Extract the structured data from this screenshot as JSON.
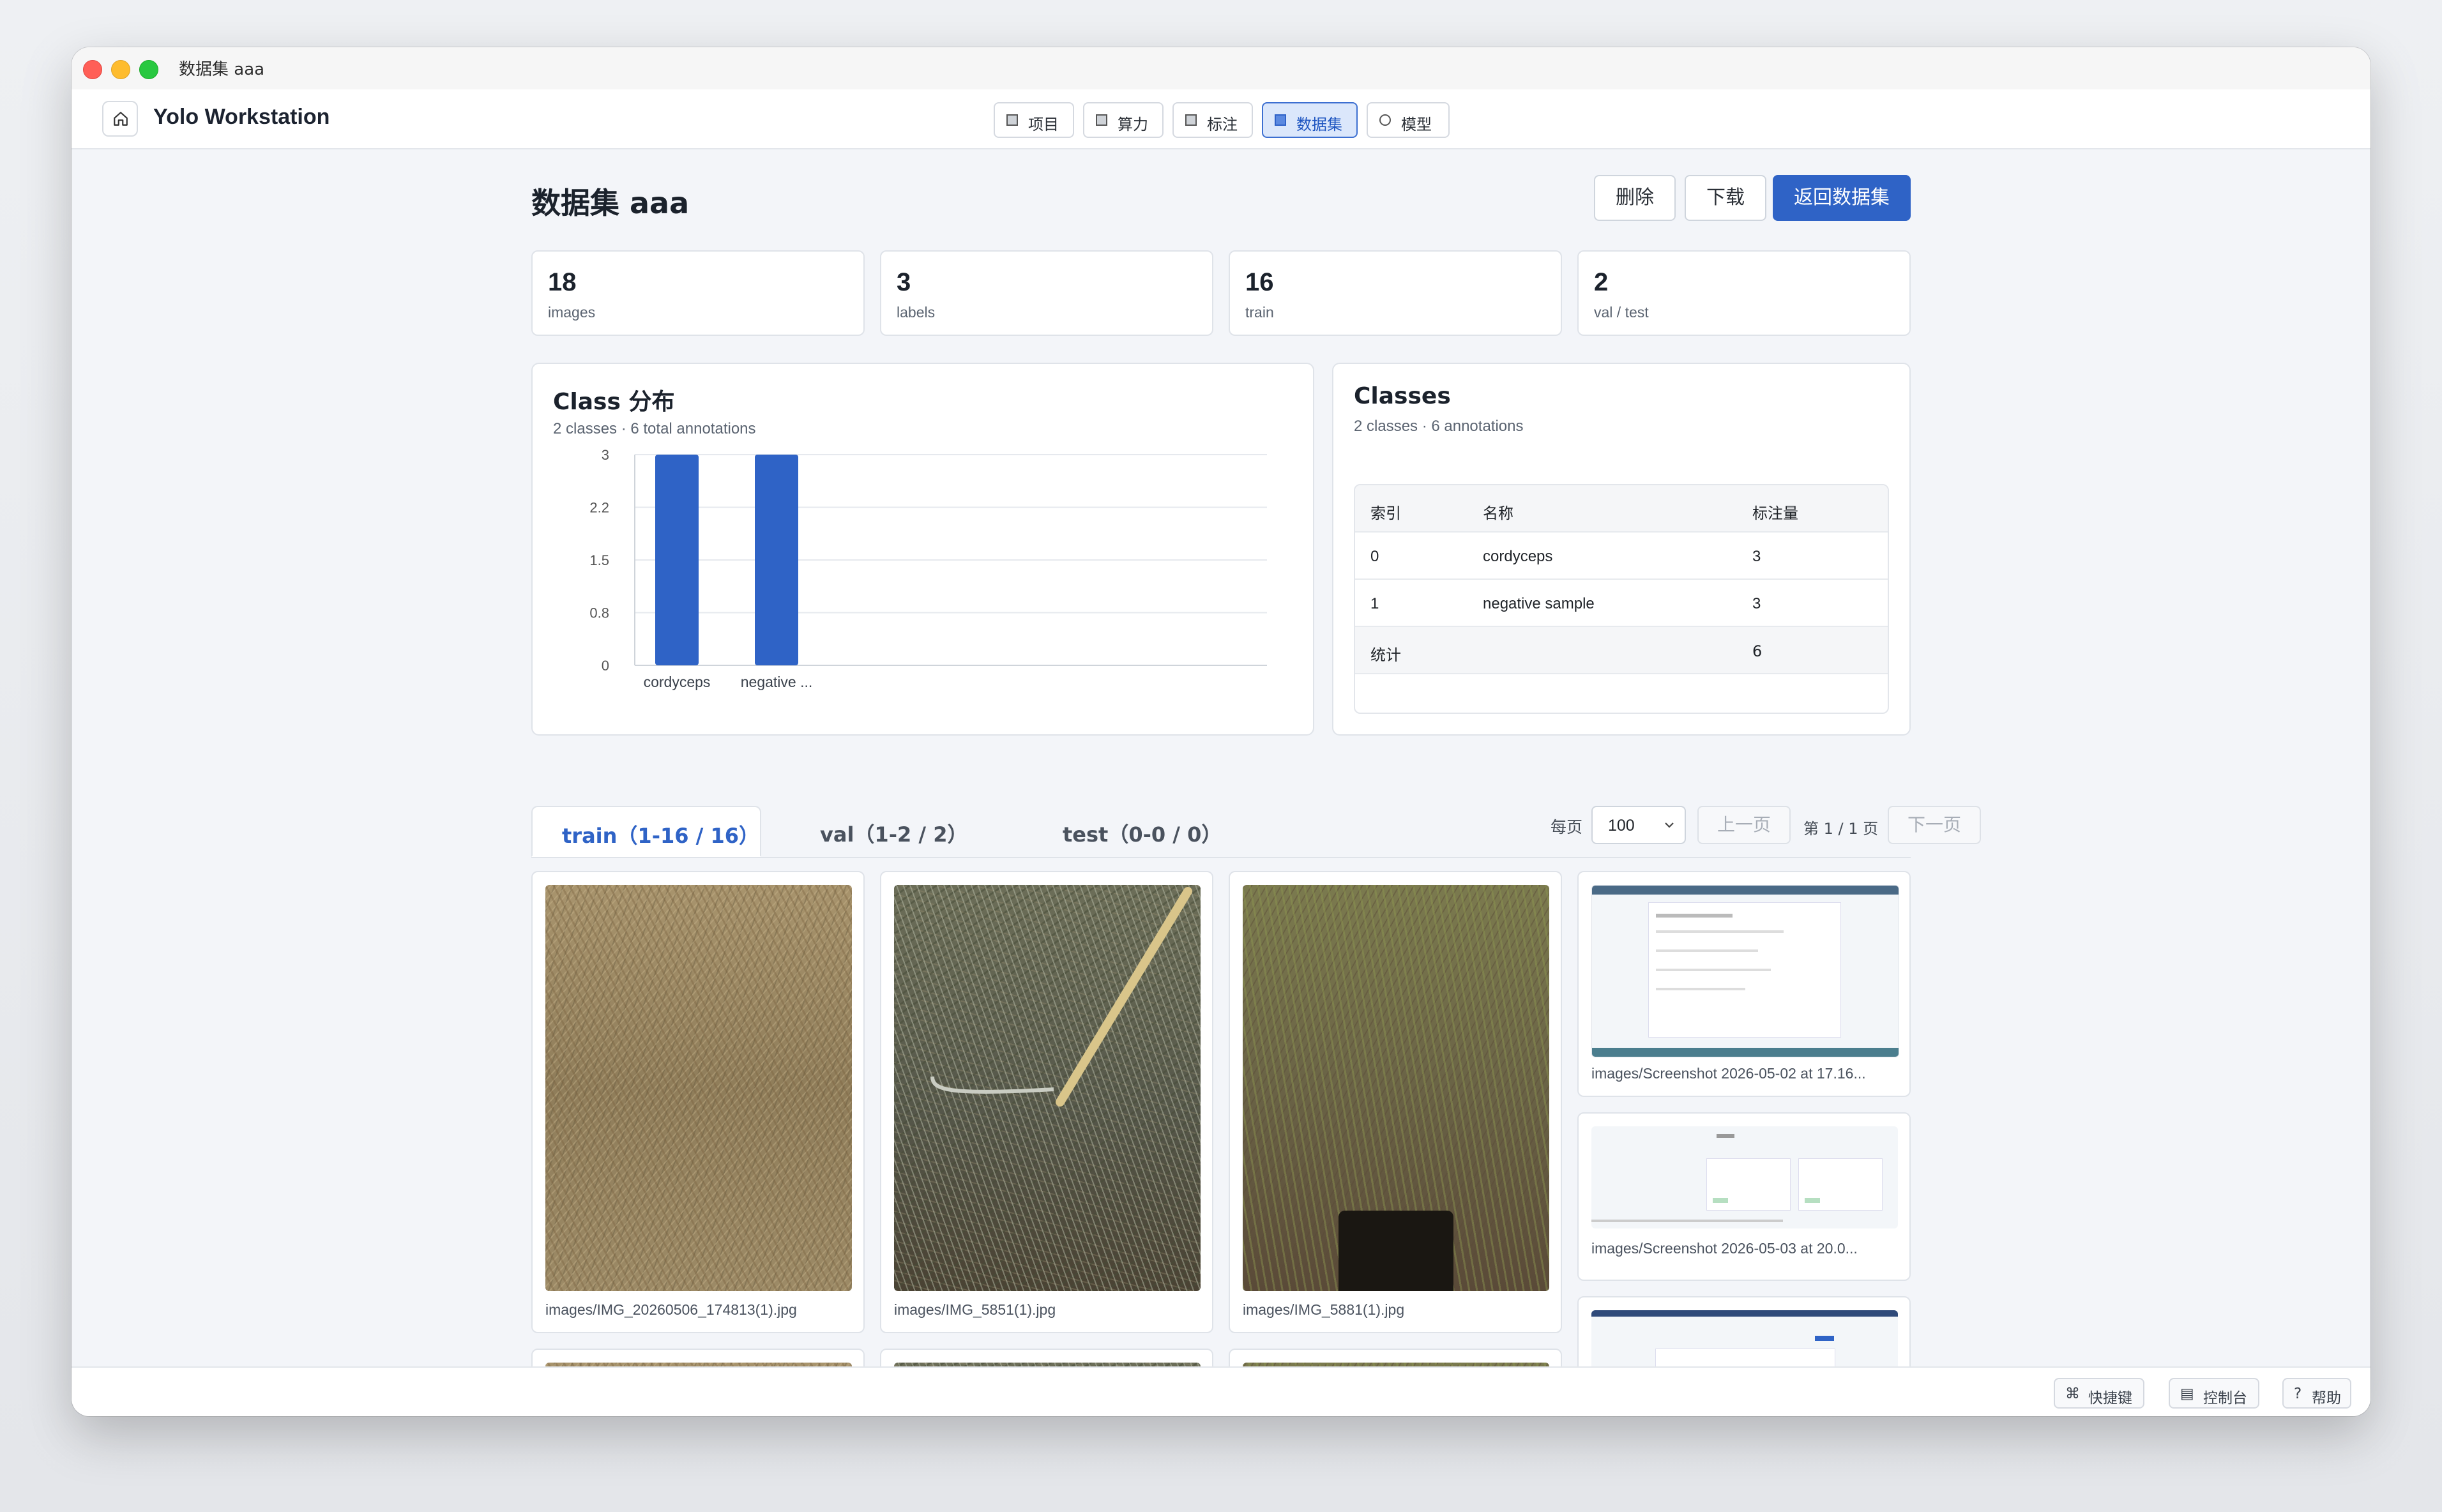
{
  "window": {
    "title": "数据集 aaa"
  },
  "app": {
    "brand": "Yolo Workstation"
  },
  "nav": [
    {
      "label": "项目",
      "icon": "square-icon",
      "active": false
    },
    {
      "label": "算力",
      "icon": "square-icon",
      "active": false
    },
    {
      "label": "标注",
      "icon": "square-icon",
      "active": false
    },
    {
      "label": "数据集",
      "icon": "square-icon",
      "active": true
    },
    {
      "label": "模型",
      "icon": "circle-icon",
      "active": false
    }
  ],
  "page": {
    "title": "数据集 aaa",
    "actions": {
      "delete": "删除",
      "download": "下载",
      "back": "返回数据集"
    }
  },
  "stats": [
    {
      "value": "18",
      "label": "images"
    },
    {
      "value": "3",
      "label": "labels"
    },
    {
      "value": "16",
      "label": "train"
    },
    {
      "value": "2",
      "label": "val / test"
    }
  ],
  "class_chart": {
    "title": "Class 分布",
    "subtitle": "2 classes · 6 total annotations"
  },
  "chart_data": {
    "type": "bar",
    "categories": [
      "cordyceps",
      "negative ..."
    ],
    "values": [
      3,
      3
    ],
    "yticks": [
      "3",
      "2.2",
      "1.5",
      "0.8",
      "0"
    ],
    "ylim": [
      0,
      3
    ],
    "grid": true,
    "color": "#2f63c6"
  },
  "classes": {
    "title": "Classes",
    "subtitle": "2 classes · 6 annotations",
    "columns": [
      "索引",
      "名称",
      "标注量"
    ],
    "rows": [
      {
        "index": "0",
        "name": "cordyceps",
        "count": "3"
      },
      {
        "index": "1",
        "name": "negative sample",
        "count": "3"
      }
    ],
    "total": {
      "label": "统计",
      "count": "6"
    }
  },
  "splits": {
    "tabs": [
      {
        "label": "train（1-16 / 16）",
        "active": true
      },
      {
        "label": "val（1-2 / 2）",
        "active": false
      },
      {
        "label": "test（0-0 / 0）",
        "active": false
      }
    ]
  },
  "pager": {
    "per_page_label": "每页",
    "per_page": "100",
    "prev": "上一页",
    "page_info": "第 1 / 1 页",
    "next": "下一页"
  },
  "images": [
    {
      "caption": "images/IMG_20260506_174813(1).jpg"
    },
    {
      "caption": "images/IMG_5851(1).jpg"
    },
    {
      "caption": "images/IMG_5881(1).jpg"
    },
    {
      "caption": "images/Screenshot 2026-05-02 at 17.16..."
    },
    {
      "caption": "images/Screenshot 2026-05-03 at 20.0..."
    }
  ],
  "footer": {
    "shortcuts": "快捷键",
    "console": "控制台",
    "help": "帮助"
  },
  "colors": {
    "accent": "#2f63c6",
    "bar": "#2f63c6"
  }
}
